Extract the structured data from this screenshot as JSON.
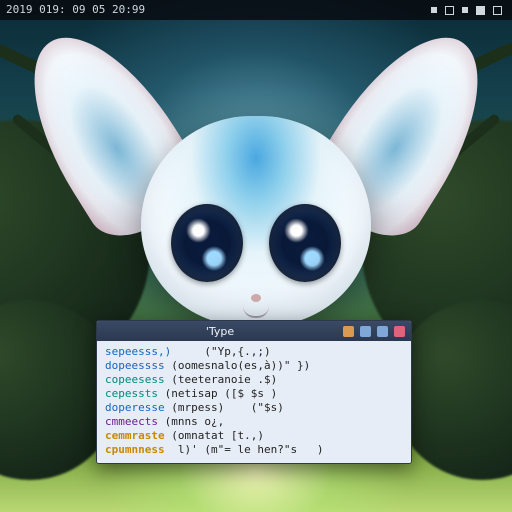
{
  "taskbar": {
    "datetime": "2019  019: 09  05  20:99"
  },
  "terminal": {
    "title": "'Type",
    "lines": [
      {
        "cls": "kw1",
        "key": "sepeesss,)",
        "rest": "     (\"Yp,{.,;)"
      },
      {
        "cls": "kw1",
        "key": "dopeessss",
        "rest": " (oomesnalo(es,à))\" })"
      },
      {
        "cls": "kw2",
        "key": "copeesess",
        "rest": " (teeteranoie .$)"
      },
      {
        "cls": "kw2",
        "key": "cepessts",
        "rest": " (netisap ([$ $s )"
      },
      {
        "cls": "kw1",
        "key": "doperesse",
        "rest": " (mrpess)    (\"$s)"
      },
      {
        "cls": "kw4",
        "key": "cmmeects",
        "rest": " (mnns o¿,"
      },
      {
        "cls": "kw3",
        "key": "cemmraste",
        "rest": " (omnatat [t.,)"
      },
      {
        "cls": "kw3",
        "key": "cpumnness",
        "rest": "  l)' (m\"= le hen?\"s   )"
      }
    ]
  }
}
